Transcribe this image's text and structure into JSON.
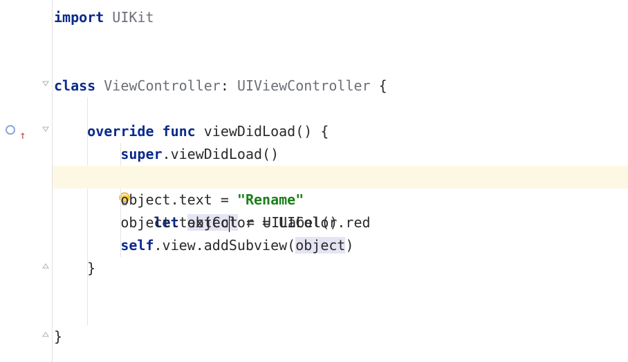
{
  "code": {
    "line1_kw": "import",
    "line1_type": " UIKit",
    "line4_kw1": "class",
    "line4_type1": " ViewController",
    "line4_colon": ": ",
    "line4_type2": "UIViewController",
    "line4_brace": " {",
    "line6_indent": "    ",
    "line6_kw1": "override",
    "line6_sp1": " ",
    "line6_kw2": "func",
    "line6_fn": " viewDidLoad",
    "line6_paren": "() {",
    "line7_indent": "        ",
    "line7_kw": "super",
    "line7_rest": ".viewDidLoad()",
    "line8_indent": "        ",
    "line8_kw": "let",
    "line8_sp": " ",
    "line8_var_a": "objec",
    "line8_var_b": "t",
    "line8_assign": " = UILabel()",
    "line9_indent": "        ",
    "line9_a": "object.text = ",
    "line9_str": "\"Rename\"",
    "line10_indent": "        ",
    "line10_a": "object.textColor = UIColor.red",
    "line11_indent": "        ",
    "line11_kw": "self",
    "line11_a": ".view.addSubview(",
    "line11_obj": "object",
    "line11_b": ")",
    "line12_indent": "    ",
    "line12_brace": "}",
    "line15_brace": "}"
  },
  "icons": {
    "override": "override-marker",
    "bulb": "intention-bulb"
  }
}
